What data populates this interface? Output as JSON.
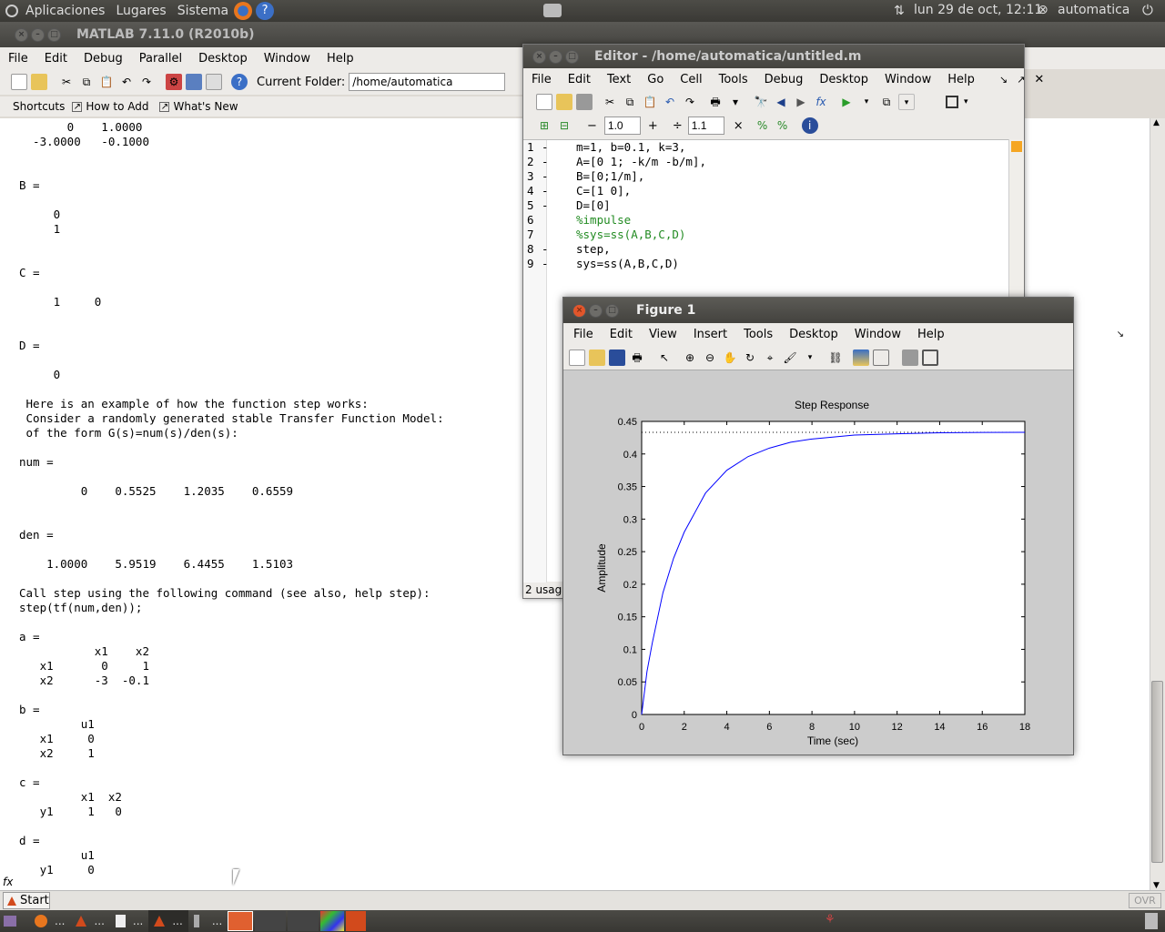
{
  "top_panel": {
    "menus": [
      "Aplicaciones",
      "Lugares",
      "Sistema"
    ],
    "datetime": "lun 29 de oct, 12:11",
    "user": "automatica"
  },
  "matlab": {
    "title": "MATLAB  7.11.0 (R2010b)",
    "menus": [
      "File",
      "Edit",
      "Debug",
      "Parallel",
      "Desktop",
      "Window",
      "Help"
    ],
    "current_folder_label": "Current Folder:",
    "current_folder": "/home/automatica",
    "shortcuts": [
      "Shortcuts",
      "How to Add",
      "What's New"
    ],
    "command_window": "       0    1.0000\n  -3.0000   -0.1000\n\n\nB =\n\n     0\n     1\n\n\nC =\n\n     1     0\n\n\nD =\n\n     0\n\n Here is an example of how the function step works:\n Consider a randomly generated stable Transfer Function Model:\n of the form G(s)=num(s)/den(s):\n\nnum =\n\n         0    0.5525    1.2035    0.6559\n\n\nden =\n\n    1.0000    5.9519    6.4455    1.5103\n\nCall step using the following command (see also, help step):\nstep(tf(num,den));\n\na = \n           x1    x2\n   x1       0     1\n   x2      -3  -0.1\n\nb = \n         u1\n   x1     0\n   x2     1\n\nc = \n         x1  x2\n   y1     1   0\n\nd = \n         u1\n   y1     0",
    "fx": "fx",
    "start": "Start",
    "ovr": "OVR"
  },
  "editor": {
    "title": "Editor - /home/automatica/untitled.m",
    "menus": [
      "File",
      "Edit",
      "Text",
      "Go",
      "Cell",
      "Tools",
      "Debug",
      "Desktop",
      "Window",
      "Help"
    ],
    "cell_val1": "1.0",
    "cell_val2": "1.1",
    "lines": [
      {
        "n": "1",
        "dash": "-",
        "code": "m=1, b=0.1, k=3,",
        "comment": false
      },
      {
        "n": "2",
        "dash": "-",
        "code": "A=[0 1; -k/m -b/m],",
        "comment": false
      },
      {
        "n": "3",
        "dash": "-",
        "code": "B=[0;1/m],",
        "comment": false
      },
      {
        "n": "4",
        "dash": "-",
        "code": "C=[1 0],",
        "comment": false
      },
      {
        "n": "5",
        "dash": "-",
        "code": "D=[0]",
        "comment": false
      },
      {
        "n": "6",
        "dash": "",
        "code": "%impulse",
        "comment": true
      },
      {
        "n": "7",
        "dash": "",
        "code": "%sys=ss(A,B,C,D)",
        "comment": true
      },
      {
        "n": "8",
        "dash": "-",
        "code": "step,",
        "comment": false
      },
      {
        "n": "9",
        "dash": "-",
        "code": "sys=ss(A,B,C,D)",
        "comment": false
      }
    ],
    "status": "2 usag"
  },
  "figure": {
    "title": "Figure 1",
    "menus": [
      "File",
      "Edit",
      "View",
      "Insert",
      "Tools",
      "Desktop",
      "Window",
      "Help"
    ]
  },
  "taskbar": {
    "items": [
      "...",
      "...",
      "...",
      "...",
      "...",
      "..."
    ]
  },
  "chart_data": {
    "type": "line",
    "title": "Step Response",
    "xlabel": "Time (sec)",
    "ylabel": "Amplitude",
    "xlim": [
      0,
      18
    ],
    "ylim": [
      0,
      0.45
    ],
    "xticks": [
      0,
      2,
      4,
      6,
      8,
      10,
      12,
      14,
      16,
      18
    ],
    "yticks": [
      0,
      0.05,
      0.1,
      0.15,
      0.2,
      0.25,
      0.3,
      0.35,
      0.4,
      0.45
    ],
    "steady_state": 0.4333,
    "series": [
      {
        "color": "#0000ff",
        "x": [
          0,
          0.25,
          0.5,
          1,
          1.5,
          2,
          3,
          4,
          5,
          6,
          7,
          8,
          10,
          12,
          14,
          16,
          18
        ],
        "y": [
          0,
          0.066,
          0.11,
          0.187,
          0.24,
          0.28,
          0.34,
          0.375,
          0.396,
          0.409,
          0.418,
          0.423,
          0.429,
          0.431,
          0.4325,
          0.433,
          0.4333
        ]
      }
    ]
  }
}
